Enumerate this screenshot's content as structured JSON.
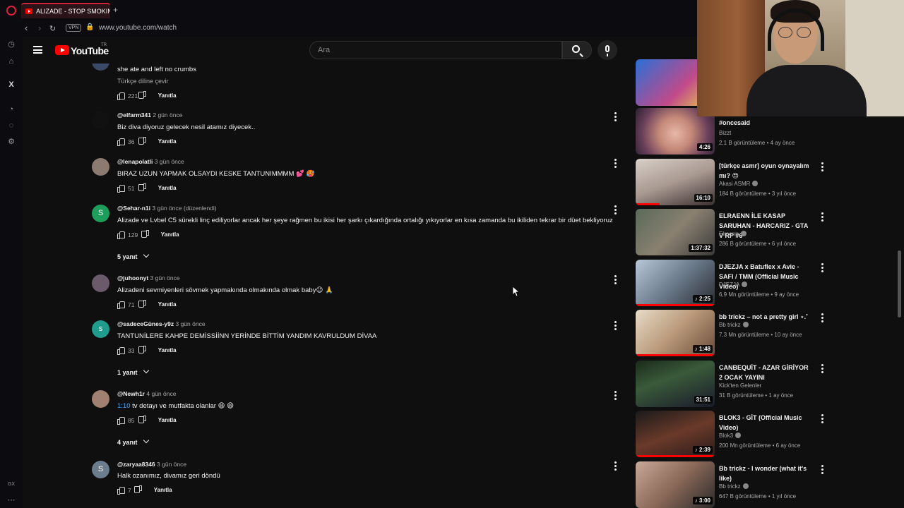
{
  "browser": {
    "tab_title": "ALIZADE - STOP SMOKING",
    "new_tab": "+",
    "vpn_label": "VPN",
    "url": "www.youtube.com/watch",
    "gx_label": "GX"
  },
  "youtube": {
    "wordmark": "YouTube",
    "region": "TR",
    "search_placeholder": "Ara"
  },
  "comments": [
    {
      "text": "she ate and left no crumbs",
      "translate": "Türkçe diline çevir",
      "likes": "221",
      "reply": "Yanıtla"
    },
    {
      "author": "@elfarm341",
      "time": "2 gün önce",
      "text": "Biz diva diyoruz gelecek nesil atamız diyecek..",
      "likes": "36",
      "reply": "Yanıtla"
    },
    {
      "author": "@lenapolatli",
      "time": "3 gün önce",
      "text": "BIRAZ UZUN YAPMAK OLSAYDI KESKE TANTUNIMMMM 💕 🥵",
      "likes": "51",
      "reply": "Yanıtla"
    },
    {
      "author": "@Sehar-n1i",
      "time": "3 gün önce (düzenlendi)",
      "avatar_letter": "S",
      "text": "Alizade ve Lvbel C5 sürekli linç ediliyorlar ancak her şeye rağmen bu ikisi her şarkı çıkardığında ortalığı yıkıyorlar en kısa zamanda bu ikiliden tekrar bir düet bekliyoruz",
      "likes": "129",
      "reply": "Yanıtla",
      "replies": "5 yanıt"
    },
    {
      "author": "@juhoonyt",
      "time": "3 gün önce",
      "text": "Alizadeni sevmiyenleri sövmek yapmakında olmakında olmak baby😉 🙏",
      "likes": "71",
      "reply": "Yanıtla"
    },
    {
      "author": "@sadeceGünes-y9z",
      "time": "3 gün önce",
      "avatar_letter": "s",
      "text": "TANTUNİLERE KAHPE DEMİSSİİNN YERİNDE BİTTİM YANDIM KAVRULDUM DİVAA",
      "likes": "33",
      "reply": "Yanıtla",
      "replies": "1 yanıt"
    },
    {
      "author": "@Newh1r",
      "time": "4 gün önce",
      "timestamp_link": "1:10",
      "text": "tv detayı ve mutfakta olanlar 😄 😄",
      "likes": "85",
      "reply": "Yanıtla",
      "replies": "4 yanıt"
    },
    {
      "author": "@zaryaa8346",
      "time": "3 gün önce",
      "avatar_letter": "S",
      "text": "Halk ozanımız, divamız geri döndü",
      "likes": "7",
      "reply": "Yanıtla"
    }
  ],
  "recommendations": [
    {
      "title": "#oncesaid",
      "channel": "Bizzt",
      "views": "2,1 B görüntüleme",
      "age": "4 ay önce",
      "duration": "4:26",
      "progress": 0
    },
    {
      "title": "[türkçe asmr] oyun oynayalım mı? 😍",
      "channel": "Akasi ASMR",
      "verified": true,
      "views": "184 B görüntüleme",
      "age": "3 yıl önce",
      "duration": "16:10",
      "progress": 0.3
    },
    {
      "title": "ELRAENN İLE KASAP SARUHAN - HARCARIZ - GTA V RP #6",
      "channel": "Elraenn",
      "verified": true,
      "views": "286 B görüntüleme",
      "age": "6 yıl önce",
      "duration": "1:37:32",
      "progress": 0
    },
    {
      "title": "DJEZJA x Batuflex x Avie - SAFI / TMM (Official Music Video)",
      "channel": "DJEZJA",
      "verified": true,
      "views": "6,9 Mn görüntüleme",
      "age": "9 ay önce",
      "duration": "♪ 2:25",
      "progress": 1
    },
    {
      "title": "bb trickz – not a pretty girl ⋆.˚",
      "channel": "Bb trickz",
      "verified": true,
      "views": "7,3 Mn görüntüleme",
      "age": "10 ay önce",
      "duration": "♪ 1:48",
      "progress": 1
    },
    {
      "title": "CANBEQUİT - AZAR GİRİYOR 2 OCAK YAYINI",
      "channel": "Kick'ten Gelenler",
      "views": "31 B görüntüleme",
      "age": "1 ay önce",
      "duration": "31:51",
      "progress": 0
    },
    {
      "title": "BLOK3 - GİT (Official Music Video)",
      "channel": "Blok3",
      "verified": true,
      "views": "200 Mn görüntüleme",
      "age": "6 ay önce",
      "duration": "♪ 2:39",
      "progress": 1
    },
    {
      "title": "Bb trickz - I wonder (what it's like)",
      "channel": "Bb trickz",
      "verified": true,
      "views": "647 B görüntüleme",
      "age": "1 yıl önce",
      "duration": "♪ 3:00",
      "progress": 0
    }
  ],
  "colors": {
    "background": "#0f0f0f",
    "accent_red": "#ff0000",
    "link_blue": "#3ea6ff"
  }
}
